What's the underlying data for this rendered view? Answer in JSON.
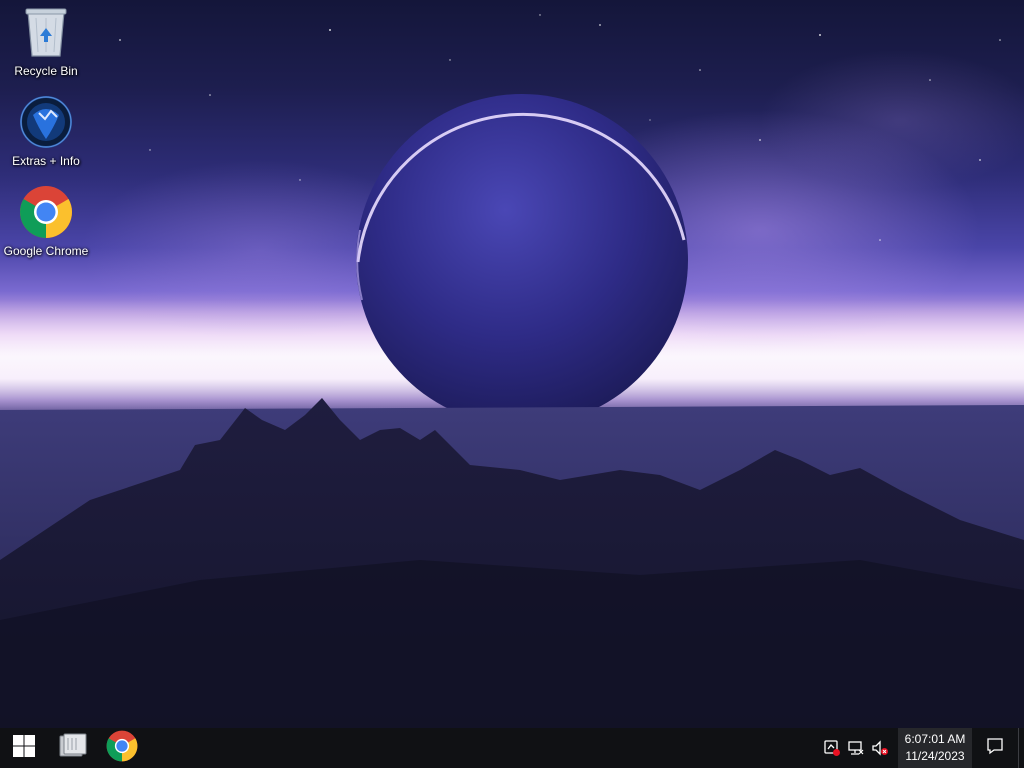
{
  "desktop": {
    "icons": [
      {
        "name": "recycle-bin",
        "label": "Recycle Bin",
        "icon": "recycle-bin-icon"
      },
      {
        "name": "extras-info",
        "label": "Extras + Info",
        "icon": "extras-info-icon"
      },
      {
        "name": "google-chrome",
        "label": "Google Chrome",
        "icon": "chrome-icon"
      }
    ]
  },
  "taskbar": {
    "start_icon": "windows-logo-icon",
    "pinned": [
      {
        "name": "file-explorer",
        "icon": "file-explorer-icon"
      },
      {
        "name": "google-chrome",
        "icon": "chrome-icon"
      }
    ],
    "tray": {
      "icons": [
        "security-alert-icon",
        "network-disconnected-icon",
        "volume-muted-icon"
      ],
      "time": "6:07:01 AM",
      "date": "11/24/2023",
      "notification_icon": "action-center-icon"
    }
  },
  "colors": {
    "taskbar_bg": "#101114",
    "alert_red": "#e81123",
    "windows_blue": "#ffffff"
  }
}
